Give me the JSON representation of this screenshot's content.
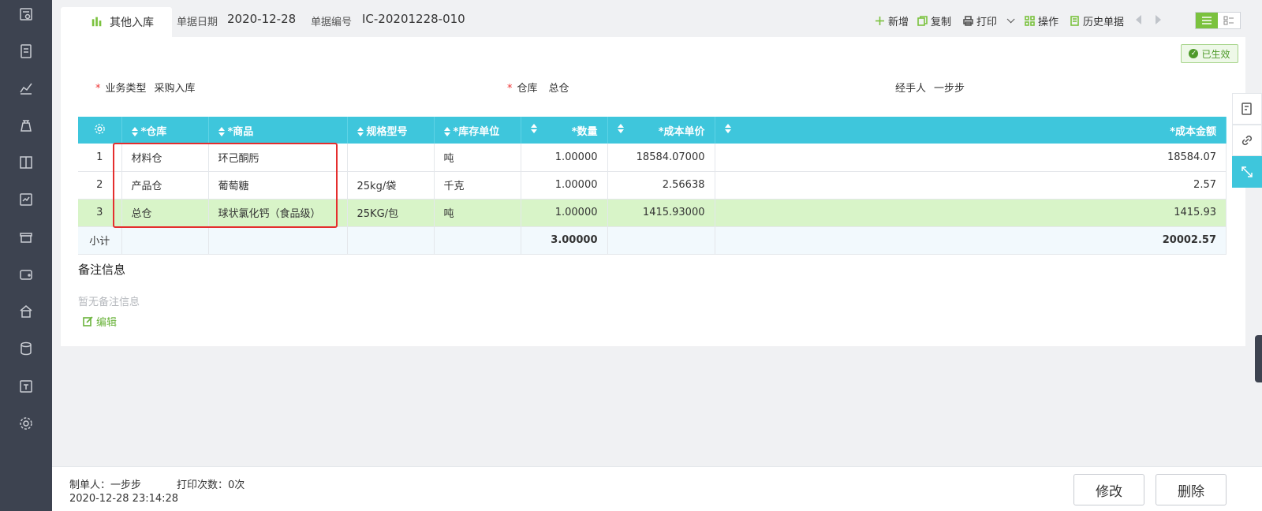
{
  "header": {
    "tab_label": "其他入库",
    "date_label": "单据日期",
    "date_value": "2020-12-28",
    "number_label": "单据编号",
    "number_value": "IC-20201228-010"
  },
  "toolbar": {
    "add": "新增",
    "copy": "复制",
    "print": "打印",
    "operate": "操作",
    "history": "历史单据"
  },
  "status": "已生效",
  "form": {
    "business_type_label": "业务类型",
    "business_type_value": "采购入库",
    "warehouse_label": "仓库",
    "warehouse_value": "总仓",
    "handler_label": "经手人",
    "handler_value": "一步步",
    "required_mark": "*"
  },
  "grid": {
    "columns": [
      "*仓库",
      "*商品",
      "规格型号",
      "*库存单位",
      "*数量",
      "*成本单价",
      "*成本金额"
    ],
    "rows": [
      {
        "index": "1",
        "warehouse": "材料仓",
        "product": "环己酮肟",
        "spec": "",
        "unit": "吨",
        "qty": "1.00000",
        "unit_cost": "18584.07000",
        "amount": "18584.07"
      },
      {
        "index": "2",
        "warehouse": "产品仓",
        "product": "葡萄糖",
        "spec": "25kg/袋",
        "unit": "千克",
        "qty": "1.00000",
        "unit_cost": "2.56638",
        "amount": "2.57"
      },
      {
        "index": "3",
        "warehouse": "总仓",
        "product": "球状氯化钙（食品级）",
        "spec": "25KG/包",
        "unit": "吨",
        "qty": "1.00000",
        "unit_cost": "1415.93000",
        "amount": "1415.93"
      }
    ],
    "subtotal_label": "小计",
    "subtotal_qty": "3.00000",
    "subtotal_amount": "20002.57"
  },
  "remarks": {
    "title": "备注信息",
    "empty_text": "暂无备注信息",
    "edit_label": "编辑"
  },
  "footer": {
    "creator": "制单人：一步步",
    "print_count": "打印次数：0次",
    "created_time": "2020-12-28 23:14:28",
    "modify_button": "修改",
    "delete_button": "删除"
  },
  "colors": {
    "accent_teal": "#3ec6dc",
    "accent_green": "#7bc23e",
    "sidebar": "#3d4350",
    "highlight_row": "#d8f4c8",
    "annotation_red": "#e52e2e"
  }
}
